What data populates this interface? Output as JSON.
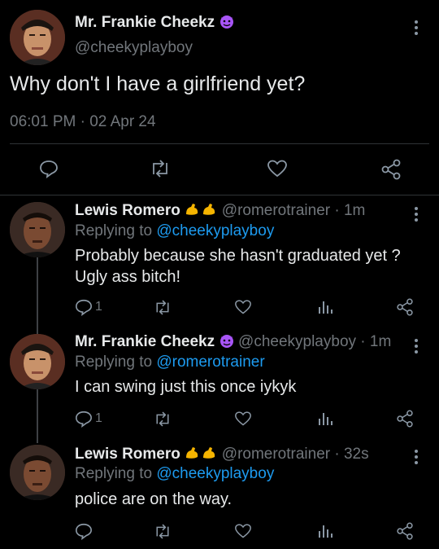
{
  "main_tweet": {
    "author_name": "Mr. Frankie Cheekz",
    "author_emoji": "😈",
    "handle": "@cheekyplayboy",
    "text": "Why don't I have a girlfriend yet?",
    "timestamp": "06:01 PM · 02 Apr 24"
  },
  "replies": [
    {
      "author_name": "Lewis Romero",
      "author_emoji": "💪💪",
      "handle_time": "@romerotrainer · 1m",
      "replying_prefix": "Replying to ",
      "replying_to": "@cheekyplayboy",
      "line1": "Probably because she hasn't graduated yet ?",
      "line2": "Ugly ass bitch!",
      "reply_count": "1"
    },
    {
      "author_name": "Mr. Frankie Cheekz",
      "author_emoji": "😈",
      "handle_time": "@cheekyplayboy · 1m",
      "replying_prefix": "Replying to ",
      "replying_to": "@romerotrainer",
      "line1": "I can swing just this once iykyk",
      "reply_count": "1"
    },
    {
      "author_name": "Lewis Romero",
      "author_emoji": "💪💪",
      "handle_time": "@romerotrainer · 32s",
      "replying_prefix": "Replying to ",
      "replying_to": "@cheekyplayboy",
      "line1": "police are on the way."
    }
  ],
  "colors": {
    "background": "#000000",
    "text": "#e7e9ea",
    "secondary": "#71767b",
    "link": "#1d9bf0",
    "purple_emoji": "#a855f7",
    "gold_emoji": "#f5b400"
  },
  "icons": [
    "more-icon",
    "reply-icon",
    "retweet-icon",
    "like-icon",
    "share-icon",
    "views-icon"
  ]
}
